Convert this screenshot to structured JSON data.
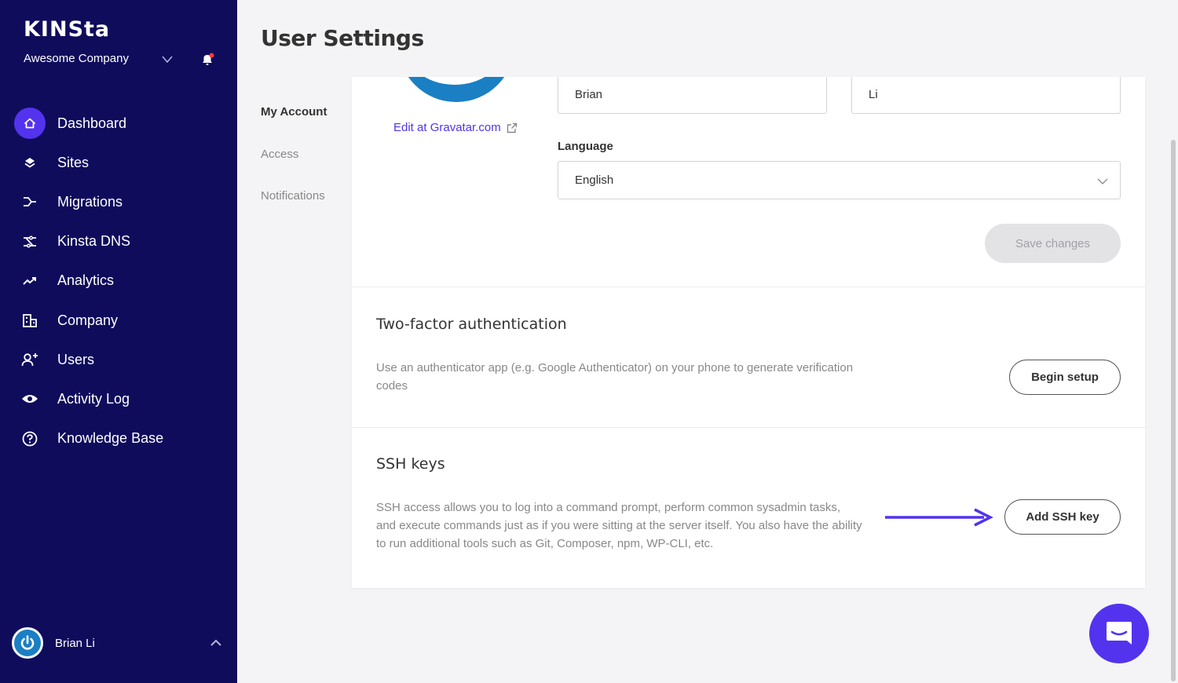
{
  "sidebar": {
    "logo": "KINSta",
    "company": "Awesome Company",
    "items": [
      {
        "label": "Dashboard",
        "icon": "home-icon",
        "active": true
      },
      {
        "label": "Sites",
        "icon": "layers-icon"
      },
      {
        "label": "Migrations",
        "icon": "migrations-icon"
      },
      {
        "label": "Kinsta DNS",
        "icon": "dns-icon"
      },
      {
        "label": "Analytics",
        "icon": "trend-icon"
      },
      {
        "label": "Company",
        "icon": "building-icon"
      },
      {
        "label": "Users",
        "icon": "add-user-icon"
      },
      {
        "label": "Activity Log",
        "icon": "eye-icon"
      },
      {
        "label": "Knowledge Base",
        "icon": "help-icon"
      }
    ],
    "user": {
      "name": "Brian Li"
    }
  },
  "page": {
    "title": "User Settings"
  },
  "subnav": {
    "items": [
      "My Account",
      "Access",
      "Notifications"
    ]
  },
  "account": {
    "gravatar_link": "Edit at Gravatar.com",
    "first_name": "Brian",
    "last_name": "Li",
    "language_label": "Language",
    "language_value": "English",
    "save_label": "Save changes"
  },
  "two_factor": {
    "title": "Two-factor authentication",
    "description": "Use an authenticator app (e.g. Google Authenticator) on your phone to generate verification codes",
    "button": "Begin setup"
  },
  "ssh": {
    "title": "SSH keys",
    "description": "SSH access allows you to log into a command prompt, perform common sysadmin tasks, and execute commands just as if you were sitting at the server itself. You also have the ability to run additional tools such as Git, Composer, npm, WP-CLI, etc.",
    "button": "Add SSH key"
  },
  "colors": {
    "sidebar": "#0f0c5c",
    "accent": "#5333ed",
    "gravatar": "#1b7fc4"
  }
}
